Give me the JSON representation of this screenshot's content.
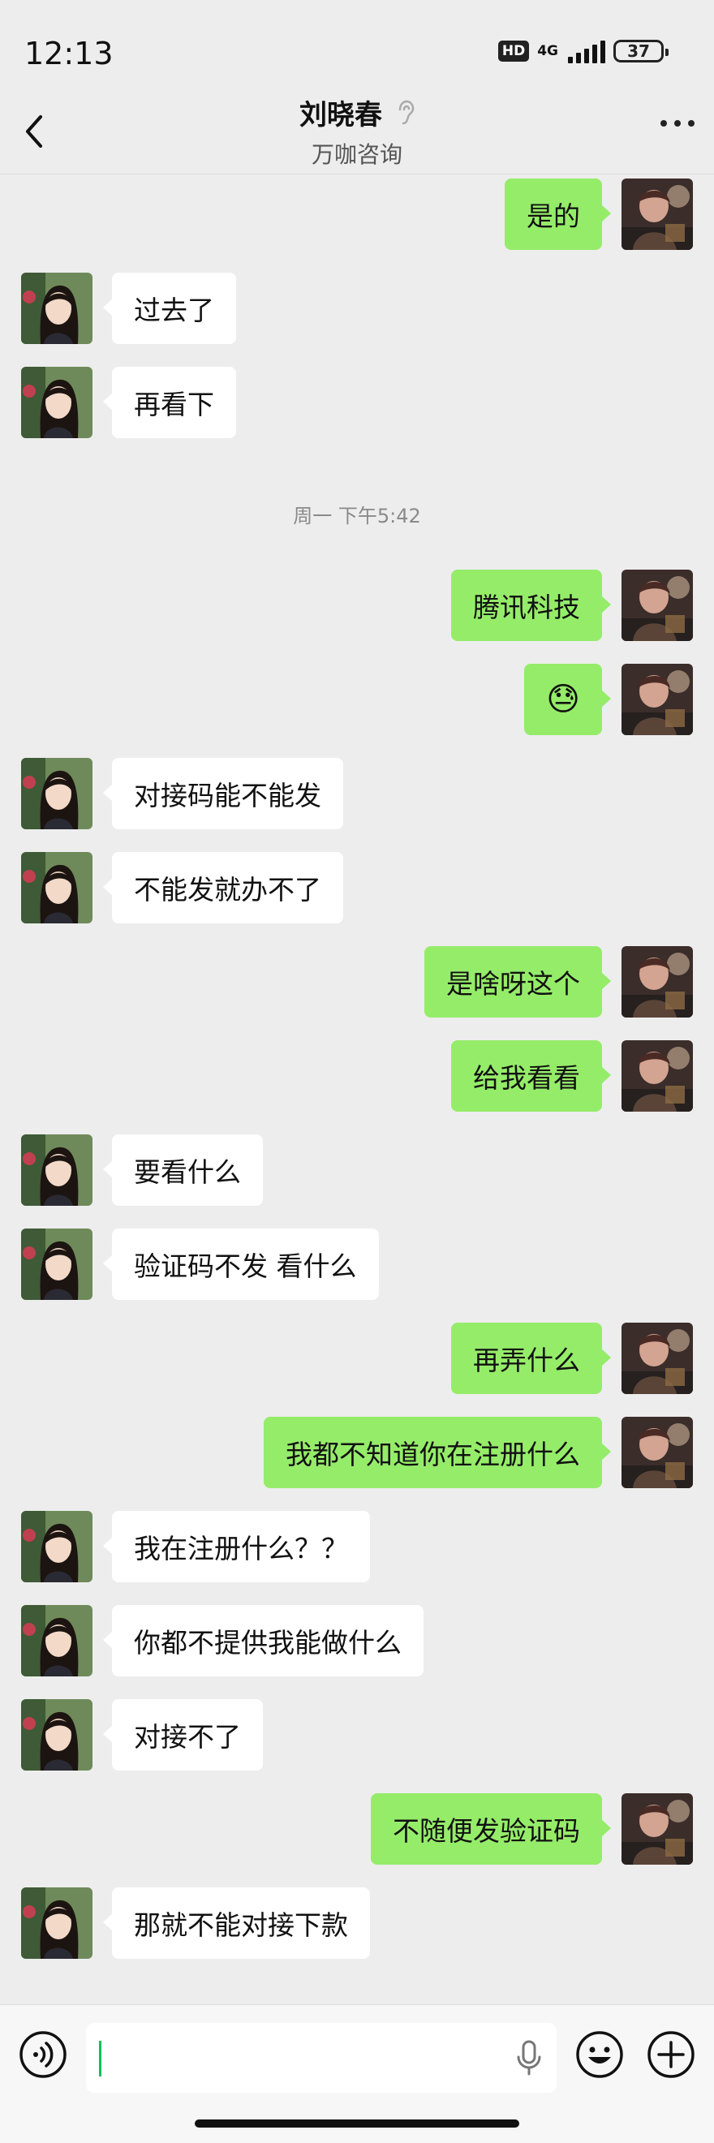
{
  "status_bar": {
    "time": "12:13",
    "hd": "HD",
    "network": "4G",
    "battery": "37"
  },
  "header": {
    "title": "刘晓春",
    "subtitle": "万咖咨询",
    "back_icon": "chevron-left-icon",
    "more_icon": "more-dots-icon",
    "ear_icon": "ear-icon"
  },
  "messages": [
    {
      "side": "out",
      "text": "是的"
    },
    {
      "side": "in",
      "text": "过去了"
    },
    {
      "side": "in",
      "text": "再看下"
    },
    {
      "timestamp": "周一 下午5:42"
    },
    {
      "side": "out",
      "text": "腾讯科技"
    },
    {
      "side": "out",
      "text": "😓"
    },
    {
      "side": "in",
      "text": "对接码能不能发"
    },
    {
      "side": "in",
      "text": "不能发就办不了"
    },
    {
      "side": "out",
      "text": "是啥呀这个"
    },
    {
      "side": "out",
      "text": "给我看看"
    },
    {
      "side": "in",
      "text": "要看什么"
    },
    {
      "side": "in",
      "text": "验证码不发 看什么"
    },
    {
      "side": "out",
      "text": "再弄什么"
    },
    {
      "side": "out",
      "text": "我都不知道你在注册什么"
    },
    {
      "side": "in",
      "text": "我在注册什么？？"
    },
    {
      "side": "in",
      "text": "你都不提供我能做什么"
    },
    {
      "side": "in",
      "text": "对接不了"
    },
    {
      "side": "out",
      "text": "不随便发验证码"
    },
    {
      "side": "in",
      "text": "那就不能对接下款"
    }
  ],
  "input_bar": {
    "voice_icon": "voice-icon",
    "mic_icon": "microphone-icon",
    "emoji_icon": "emoji-icon",
    "plus_icon": "plus-icon",
    "value": ""
  },
  "colors": {
    "background": "#ededed",
    "outgoing_bubble": "#95ec69",
    "incoming_bubble": "#ffffff",
    "caret": "#07c160"
  }
}
